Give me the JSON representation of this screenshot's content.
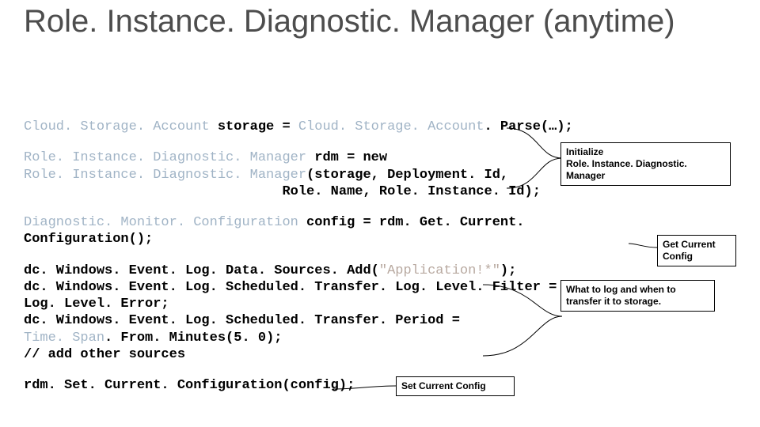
{
  "title": "Role. Instance. Diagnostic. Manager (anytime)",
  "code": {
    "b1": {
      "t1": "Cloud. Storage. Account",
      "p1": " storage = ",
      "t2": "Cloud. Storage. Account",
      "p2": ". Parse(…);"
    },
    "b2": {
      "t1": "Role. Instance. Diagnostic. Manager",
      "p1": " rdm = new\n",
      "t2": "Role. Instance. Diagnostic. Manager",
      "p2": "(storage, Deployment. Id,\n",
      "p3": "                                Role. Name, Role. Instance. Id);"
    },
    "b3": {
      "t1": "Diagnostic. Monitor. Configuration",
      "p1": " config = rdm. Get. Current. Configuration();"
    },
    "b4": {
      "p1": "dc. Windows. Event. Log. Data. Sources. Add(",
      "s1": "\"Application!*\"",
      "p2": ");\ndc. Windows. Event. Log. Scheduled. Transfer. Log. Level. Filter =\nLog. Level. Error;\ndc. Windows. Event. Log. Scheduled. Transfer. Period =\n",
      "t1": "Time. Span",
      "p3": ". From. Minutes(5. 0);\n// add other sources"
    },
    "b5": {
      "p1": "rdm. Set. Current. Configuration(config);"
    }
  },
  "callouts": {
    "c1": "Initialize\nRole. Instance. Diagnostic. Manager",
    "c2": "Get Current Config",
    "c3": "What to log and when to transfer it to storage.",
    "c4": "Set Current Config"
  }
}
